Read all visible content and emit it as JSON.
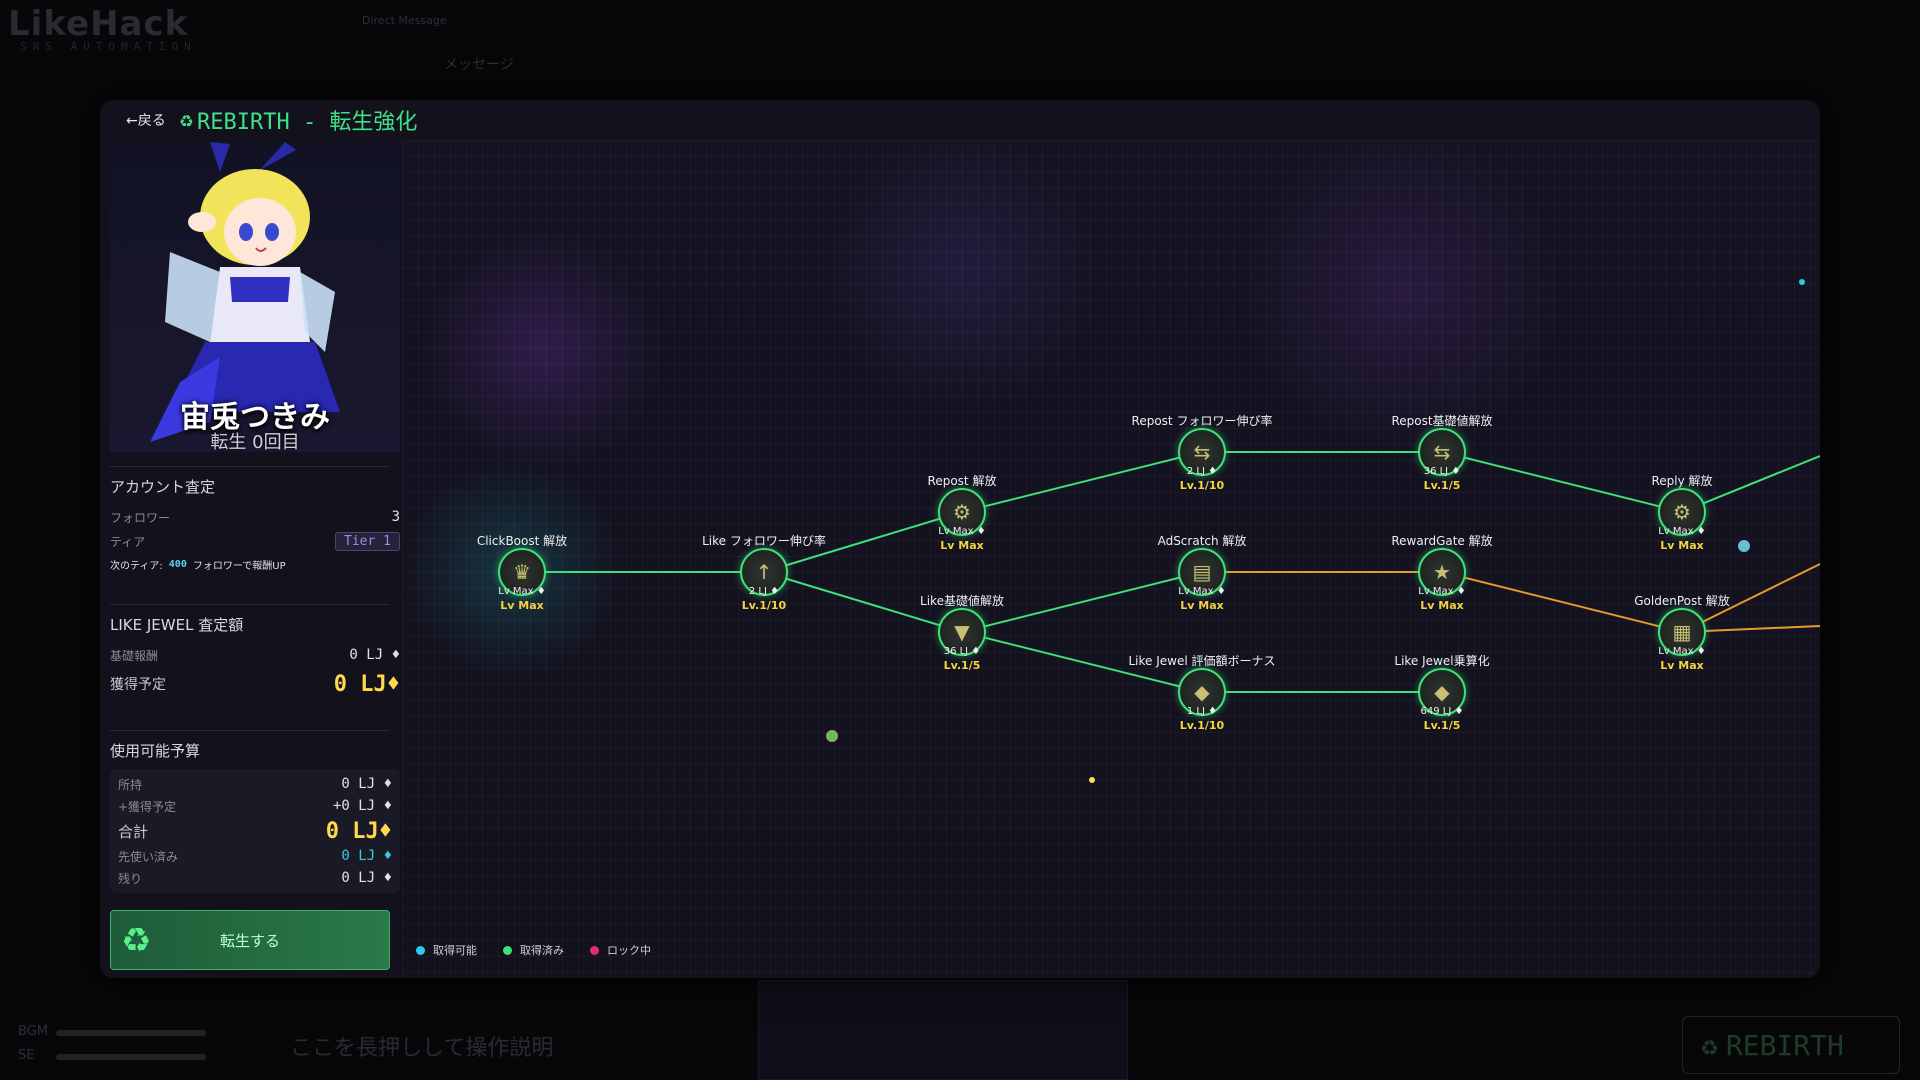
{
  "background": {
    "logo": "LikeHack",
    "logo_sub": "SNS AUTOMATION",
    "direct_message": "Direct Message",
    "message": "メッセージ",
    "help_text": "ここを長押しして操作説明",
    "bgm_label": "BGM",
    "se_label": "SE",
    "rebirth_button": "REBIRTH"
  },
  "modal": {
    "back_label": "←戻る",
    "title": "REBIRTH - 転生強化"
  },
  "character": {
    "name": "宙兎つきみ",
    "subtitle": "転生 0回目"
  },
  "account": {
    "title": "アカウント査定",
    "follower_label": "フォロワー",
    "follower_value": "3",
    "tier_label": "ティア",
    "tier_value": "Tier 1",
    "next_tier_prefix": "次のティア:",
    "next_tier_value": "400",
    "next_tier_suffix": "フォロワーで報酬UP"
  },
  "jewel": {
    "title": "LIKE JEWEL 査定額",
    "base_label": "基礎報酬",
    "base_value": "0 LJ",
    "expected_label": "獲得予定",
    "expected_value": "0 LJ"
  },
  "budget": {
    "title": "使用可能予算",
    "owned_label": "所持",
    "owned_value": "0 LJ",
    "plus_label": "+獲得予定",
    "plus_value": "+0 LJ",
    "total_label": "合計",
    "total_value": "0 LJ",
    "spent_label": "先使い済み",
    "spent_value": "0 LJ",
    "remain_label": "残り",
    "remain_value": "0 LJ"
  },
  "rebirth_button": "転生する",
  "legend": {
    "available": "取得可能",
    "acquired": "取得済み",
    "locked": "ロック中"
  },
  "colors": {
    "available": "#2ec8ef",
    "acquired": "#3ee07a",
    "locked": "#e0306a",
    "gold": "#ffd94a",
    "edge_green": "#3ee07a",
    "edge_orange": "#e89a28"
  },
  "nodes": [
    {
      "label": "ClickBoost 解放",
      "cost": "Lv Max",
      "lv": "Lv Max",
      "icon": "♛"
    },
    {
      "label": "Like フォロワー伸び率",
      "cost": "2 LJ",
      "lv": "Lv.1/10",
      "icon": "↑"
    },
    {
      "label": "Repost 解放",
      "cost": "Lv Max",
      "lv": "Lv Max",
      "icon": "⚙"
    },
    {
      "label": "Like基礎値解放",
      "cost": "36 LJ",
      "lv": "Lv.1/5",
      "icon": "▼"
    },
    {
      "label": "Repost フォロワー伸び率",
      "cost": "2 LJ",
      "lv": "Lv.1/10",
      "icon": "⇆"
    },
    {
      "label": "AdScratch 解放",
      "cost": "Lv Max",
      "lv": "Lv Max",
      "icon": "▤"
    },
    {
      "label": "Like Jewel 評価額ボーナス",
      "cost": "1 LJ",
      "lv": "Lv.1/10",
      "icon": "◆"
    },
    {
      "label": "Repost基礎値解放",
      "cost": "36 LJ",
      "lv": "Lv.1/5",
      "icon": "⇆"
    },
    {
      "label": "RewardGate 解放",
      "cost": "Lv Max",
      "lv": "Lv Max",
      "icon": "★"
    },
    {
      "label": "Like Jewel乗算化",
      "cost": "649 LJ",
      "lv": "Lv.1/5",
      "icon": "◆"
    },
    {
      "label": "Reply 解放",
      "cost": "Lv Max",
      "lv": "Lv Max",
      "icon": "⚙"
    },
    {
      "label": "GoldenPost 解放",
      "cost": "Lv Max",
      "lv": "Lv Max",
      "icon": "▦"
    }
  ]
}
